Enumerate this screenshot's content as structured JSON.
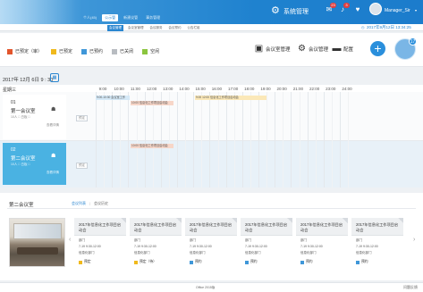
{
  "header": {
    "system_title": "系统管理",
    "user_name": "Manager_Sir",
    "mail_badge": "23",
    "bell_badge": "3",
    "nav_tabs": [
      "个人(45)",
      "公示管",
      "新建议管",
      "事务管理"
    ],
    "subtabs": [
      "会议管理",
      "会议室管理",
      "会议服务",
      "会议预约",
      "公告栏组"
    ],
    "date_time": "2017年9月12日  13:34:25"
  },
  "legend": [
    {
      "label": "已预定（审）",
      "color": "#e2552c"
    },
    {
      "label": "已预定",
      "color": "#f0b91c"
    },
    {
      "label": "已预约",
      "color": "#3f97d8"
    },
    {
      "label": "已关闭",
      "color": "#b8bcc1"
    },
    {
      "label": "空闲",
      "color": "#8bc53f"
    }
  ],
  "toolbar": {
    "meeting_mgmt": "会议室管理",
    "order_mgmt": "会议管理",
    "config": "配置",
    "add": "+",
    "profile_badge": "17"
  },
  "schedule": {
    "date_label": "2017年 12月 6日  9 : 30",
    "week_label": "星期三",
    "hours": [
      "9:00",
      "10:00",
      "11:00",
      "12:00",
      "13:00",
      "14:00",
      "15:00",
      "16:00",
      "17:00",
      "18:00",
      "19:00",
      "20:00",
      "21:00",
      "22:00",
      "23:00",
      "24:00"
    ],
    "rooms": [
      {
        "num": "01",
        "name": "第一会议室",
        "sub": "10人 □ 白板 □",
        "link": "查看详情",
        "tag": "预定",
        "events": [
          {
            "label": "9:00-10:30 会议室工作",
            "color": "#d5e9f7"
          },
          {
            "label": "10:00 信息化工作项目启动会",
            "color": "#f7d6c8"
          },
          {
            "label": "9:00 12:00 信息化工作项目启动会",
            "color": "#fbe8b8"
          }
        ]
      },
      {
        "num": "02",
        "name": "第二会议室",
        "sub": "10人 □ 白板 □",
        "link": "查看详情",
        "tag": "预定",
        "events": [
          {
            "label": "10:00 信息化工作项目启动会",
            "color": "#f7d6c8"
          }
        ]
      }
    ]
  },
  "detail": {
    "room_title": "第二会议室",
    "tabs": [
      "会议列表",
      "会议历史"
    ],
    "arrow_left": "‹",
    "arrow_right": "›",
    "meetings": [
      {
        "title": "2017年信息化工作项目启动会",
        "dept": "部门",
        "time": "7-19   9:30-12:00",
        "who": "信息化部门",
        "status": "预定",
        "status_color": "#f0b91c"
      },
      {
        "title": "2017年信息化工作项目启动会",
        "dept": "部门",
        "time": "7-19   9:30-12:00",
        "who": "信息化部门",
        "status": "预定（待）",
        "status_color": "#f0b91c"
      },
      {
        "title": "2017年信息化工作项目启动会",
        "dept": "部门",
        "time": "7-19   9:30-12:00",
        "who": "信息化部门",
        "status": "预约",
        "status_color": "#3f97d8"
      },
      {
        "title": "2017年信息化工作项目启动会",
        "dept": "部门",
        "time": "7-19   9:30-12:00",
        "who": "信息化部门",
        "status": "预约",
        "status_color": "#3f97d8"
      },
      {
        "title": "2017年信息化工作项目启动会",
        "dept": "部门",
        "time": "7-19   9:30-12:00",
        "who": "信息化部门",
        "status": "预约",
        "status_color": "#3f97d8"
      },
      {
        "title": "2017年信息化工作项目启动会",
        "dept": "部门",
        "time": "7-19   9:30-12:00",
        "who": "信息化部门",
        "status": "预约",
        "status_color": "#3f97d8"
      }
    ]
  },
  "footer": {
    "center": "Office  2015版",
    "right": "问题反馈"
  }
}
